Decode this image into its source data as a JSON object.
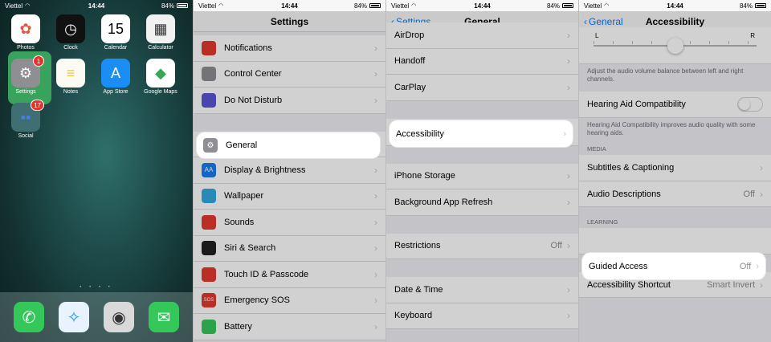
{
  "status": {
    "carrier": "Viettel",
    "time": "14:44",
    "battery": "84%"
  },
  "home": {
    "apps": [
      {
        "label": "Photos",
        "icon": "photos-icon",
        "bg": "#ffffff",
        "glyph": "✿",
        "color": "#e8543a"
      },
      {
        "label": "Clock",
        "icon": "clock-icon",
        "bg": "#111111",
        "glyph": "◷",
        "color": "#ffffff"
      },
      {
        "label": "Calendar",
        "icon": "calendar-icon",
        "bg": "#ffffff",
        "glyph": "15",
        "color": "#000000",
        "top": "Monday"
      },
      {
        "label": "Calculator",
        "icon": "calculator-icon",
        "bg": "#f1f1f1",
        "glyph": "▦",
        "color": "#333333"
      },
      {
        "label": "Settings",
        "icon": "gear-icon",
        "bg": "#8e8e93",
        "glyph": "⚙",
        "color": "#ffffff",
        "badge": "1"
      },
      {
        "label": "Notes",
        "icon": "notes-icon",
        "bg": "#fbfbf3",
        "glyph": "≡",
        "color": "#f0c93a"
      },
      {
        "label": "App Store",
        "icon": "app-store-icon",
        "bg": "#1b8ef5",
        "glyph": "A",
        "color": "#ffffff"
      },
      {
        "label": "Google Maps",
        "icon": "google-maps-icon",
        "bg": "#ffffff",
        "glyph": "◆",
        "color": "#34a853"
      },
      {
        "label": "Social",
        "icon": "social-folder-icon",
        "bg": "#3f6f72",
        "glyph": "▪▪",
        "color": "#4a7de0",
        "badge": "17"
      }
    ],
    "dock": [
      {
        "icon": "phone-icon",
        "bg": "#34c759",
        "glyph": "✆"
      },
      {
        "icon": "safari-icon",
        "bg": "#e9f3ff",
        "glyph": "✧"
      },
      {
        "icon": "camera-icon",
        "bg": "#d9d9d9",
        "glyph": "◉"
      },
      {
        "icon": "messages-icon",
        "bg": "#34c759",
        "glyph": "✉"
      }
    ]
  },
  "settings": {
    "title": "Settings",
    "group1": [
      {
        "label": "Notifications",
        "icon": "notifications-icon",
        "color": "#e5392e"
      },
      {
        "label": "Control Center",
        "icon": "control-center-icon",
        "color": "#8e8e93"
      },
      {
        "label": "Do Not Disturb",
        "icon": "moon-icon",
        "color": "#5b54d6"
      }
    ],
    "group2": [
      {
        "label": "General",
        "icon": "gear-icon",
        "color": "#8e8e93"
      },
      {
        "label": "Display & Brightness",
        "icon": "display-icon",
        "color": "#1c7cf2",
        "glyph": "AA"
      },
      {
        "label": "Wallpaper",
        "icon": "wallpaper-icon",
        "color": "#32a9e1"
      },
      {
        "label": "Sounds",
        "icon": "sounds-icon",
        "color": "#e5392e"
      },
      {
        "label": "Siri & Search",
        "icon": "siri-icon",
        "color": "#222222"
      },
      {
        "label": "Touch ID & Passcode",
        "icon": "fingerprint-icon",
        "color": "#e5392e"
      },
      {
        "label": "Emergency SOS",
        "icon": "sos-icon",
        "color": "#e5392e",
        "glyph": "SOS"
      },
      {
        "label": "Battery",
        "icon": "battery-icon",
        "color": "#34c759"
      }
    ]
  },
  "general": {
    "back": "Settings",
    "title": "General",
    "group1": [
      {
        "label": "AirDrop"
      },
      {
        "label": "Handoff"
      },
      {
        "label": "CarPlay"
      }
    ],
    "highlight": "Accessibility",
    "group2": [
      {
        "label": "iPhone Storage"
      },
      {
        "label": "Background App Refresh"
      }
    ],
    "group3": [
      {
        "label": "Restrictions",
        "value": "Off"
      }
    ],
    "group4": [
      {
        "label": "Date & Time"
      },
      {
        "label": "Keyboard"
      }
    ]
  },
  "accessibility": {
    "back": "General",
    "title": "Accessibility",
    "balance": {
      "left": "L",
      "right": "R",
      "level": 0.5
    },
    "balance_footer": "Adjust the audio volume balance between left and right channels.",
    "hearing_aid": "Hearing Aid Compatibility",
    "hearing_aid_footer": "Hearing Aid Compatibility improves audio quality with some hearing aids.",
    "media_header": "MEDIA",
    "media": [
      {
        "label": "Subtitles & Captioning",
        "value": ""
      },
      {
        "label": "Audio Descriptions",
        "value": "Off"
      }
    ],
    "learning_header": "LEARNING",
    "guided_access": {
      "label": "Guided Access",
      "value": "Off"
    },
    "shortcut": {
      "label": "Accessibility Shortcut",
      "value": "Smart Invert"
    }
  }
}
